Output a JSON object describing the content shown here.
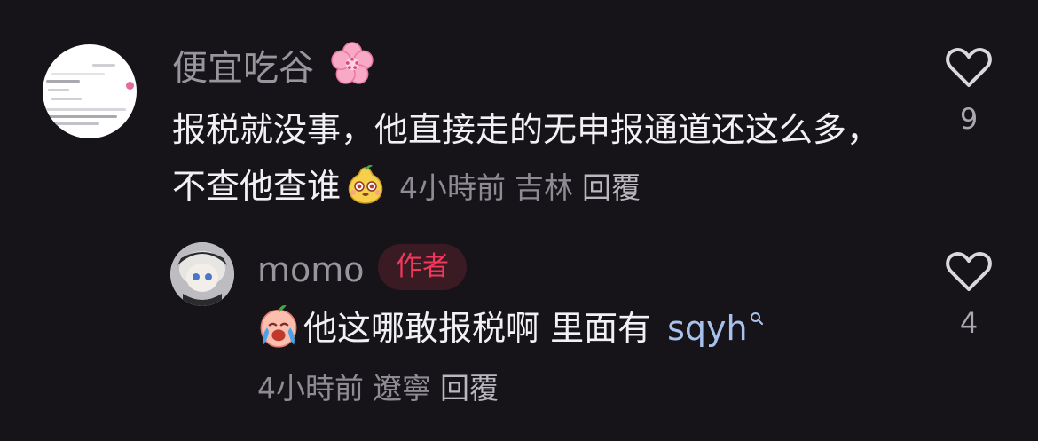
{
  "comments": [
    {
      "username": "便宜吃谷",
      "username_emoji": "cherry-blossom-icon",
      "text": "报税就没事，他直接走的无申报通道还这么多，不查他查谁",
      "text_emoji": "pear-face-emoji",
      "time": "4小時前",
      "location": "吉林",
      "reply_label": "回覆",
      "likes": "9"
    },
    {
      "username": "momo",
      "badge": "作者",
      "lead_emoji": "crying-peach-emoji",
      "text": "他这哪敢报税啊 里面有",
      "link_text": "sqyh",
      "time": "4小時前",
      "location": "遼寧",
      "reply_label": "回覆",
      "likes": "4"
    }
  ],
  "colors": {
    "background": "#161419",
    "text_primary": "#f1f0f4",
    "text_secondary": "#8d8c93",
    "badge_text": "#f0385a",
    "badge_bg": "#3a1b23",
    "link": "#a8c1ec"
  }
}
